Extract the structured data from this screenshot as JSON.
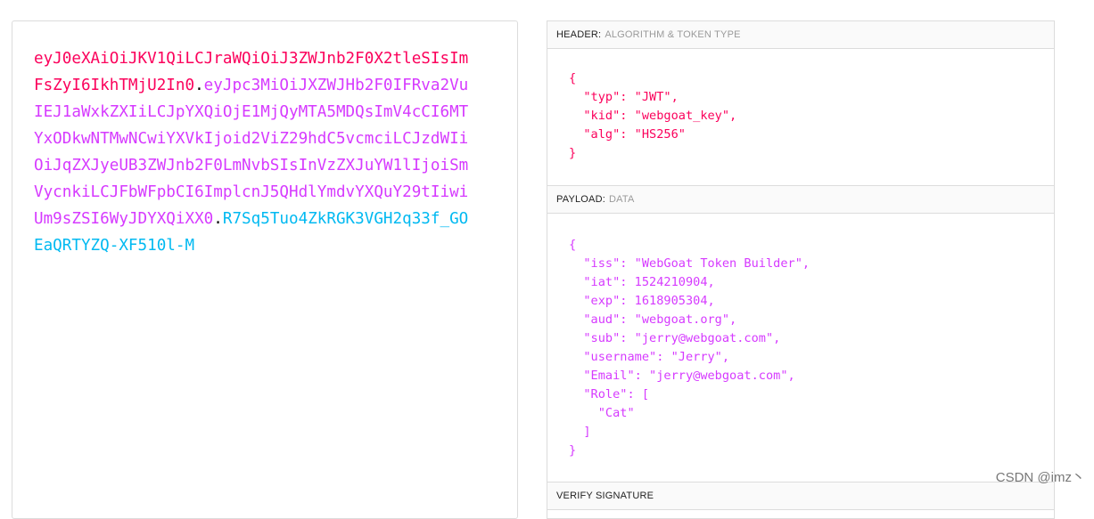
{
  "encoded": {
    "header_part": "eyJ0eXAiOiJKV1QiLCJraWQiOiJ3ZWJnb2F0X2tleSIsImFsZyI6IkhTMjU2In0",
    "payload_part": "eyJpc3MiOiJXZWJHb2F0IFRva2VuIEJ1aWxkZXIiLCJpYXQiOjE1MjQyMTA5MDQsImV4cCI6MTYxODkwNTMwNCwiYXVkIjoid2ViZ29hdC5vcmciLCJzdWIiOiJqZXJyeUB3ZWJnb2F0LmNvbSIsInVzZXJuYW1lIjoiSmVycnkiLCJFbWFpbCI6ImplcnJ5QHdlYmdvYXQuY29tIiwiUm9sZSI6WyJDYXQiXX0",
    "signature_part": "R7Sq5Tuo4ZkRGK3VGH2q33f_GOEaQRTYZQ-XF510l-M",
    "dot": "."
  },
  "header_section": {
    "title": "HEADER:",
    "subtitle": "ALGORITHM & TOKEN TYPE",
    "json": "{\n  \"typ\": \"JWT\",\n  \"kid\": \"webgoat_key\",\n  \"alg\": \"HS256\"\n}"
  },
  "payload_section": {
    "title": "PAYLOAD:",
    "subtitle": "DATA",
    "json": "{\n  \"iss\": \"WebGoat Token Builder\",\n  \"iat\": 1524210904,\n  \"exp\": 1618905304,\n  \"aud\": \"webgoat.org\",\n  \"sub\": \"jerry@webgoat.com\",\n  \"username\": \"Jerry\",\n  \"Email\": \"jerry@webgoat.com\",\n  \"Role\": [\n    \"Cat\"\n  ]\n}"
  },
  "verify_section": {
    "title": "VERIFY SIGNATURE"
  },
  "watermark": "CSDN @imz丶",
  "colors": {
    "header": "#fb015b",
    "payload": "#d63aff",
    "signature": "#00b9f1"
  }
}
